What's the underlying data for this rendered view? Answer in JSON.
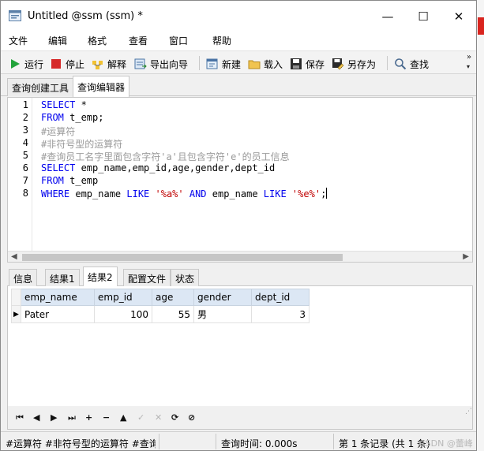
{
  "window": {
    "title": "Untitled @ssm (ssm) *",
    "minimize_glyph": "—",
    "maximize_glyph": "☐",
    "close_glyph": "✕"
  },
  "menu": {
    "items": [
      "文件",
      "编辑",
      "格式",
      "查看",
      "窗口",
      "帮助"
    ]
  },
  "toolbar": {
    "run": "运行",
    "stop": "停止",
    "explain": "解释",
    "export_wizard": "导出向导",
    "new": "新建",
    "load": "载入",
    "save": "保存",
    "save_as": "另存为",
    "find": "查找",
    "more_glyph": "»"
  },
  "query_tabs": [
    "查询创建工具",
    "查询编辑器"
  ],
  "editor": {
    "line_numbers": [
      "1",
      "2",
      "3",
      "4",
      "5",
      "6",
      "7",
      "8"
    ],
    "lines": [
      {
        "a": "SELECT",
        "b": " *"
      },
      {
        "a": "FROM",
        "b": " t_emp;"
      },
      {
        "c": "#运算符"
      },
      {
        "c": "#非符号型的运算符"
      },
      {
        "c": "#查询员工名字里面包含字符'a'且包含字符'e'的员工信息"
      },
      {
        "a": "SELECT",
        "b": " emp_name,emp_id,age,gender,dept_id"
      },
      {
        "a": "FROM",
        "b": " t_emp"
      },
      {
        "a": "WHERE",
        "b": " emp_name ",
        "k2": "LIKE",
        "s1": " '%a%' ",
        "k3": "AND",
        "b2": " emp_name ",
        "k4": "LIKE",
        "s2": " '%e%'",
        "end": ";"
      }
    ]
  },
  "result_tabs": [
    "信息",
    "结果1",
    "结果2",
    "配置文件",
    "状态"
  ],
  "grid": {
    "columns": [
      "emp_name",
      "emp_id",
      "age",
      "gender",
      "dept_id"
    ],
    "rows": [
      [
        "Pater",
        "100",
        "55",
        "男",
        "3"
      ]
    ],
    "row_indicator": "▶"
  },
  "navigator": {
    "first": "⏮",
    "prev": "◀",
    "next": "▶",
    "last": "⏭",
    "add": "+",
    "delete": "−",
    "up": "▲",
    "apply": "✓",
    "discard": "✕",
    "refresh": "⟳",
    "stop": "⊘"
  },
  "status": {
    "query_snippet": "#运算符 #非符号型的运算符 #查询",
    "query_time": "查询时间: 0.000s",
    "records": "第 1 条记录 (共 1 条)",
    "watermark": "CSDN @蕾峰"
  }
}
